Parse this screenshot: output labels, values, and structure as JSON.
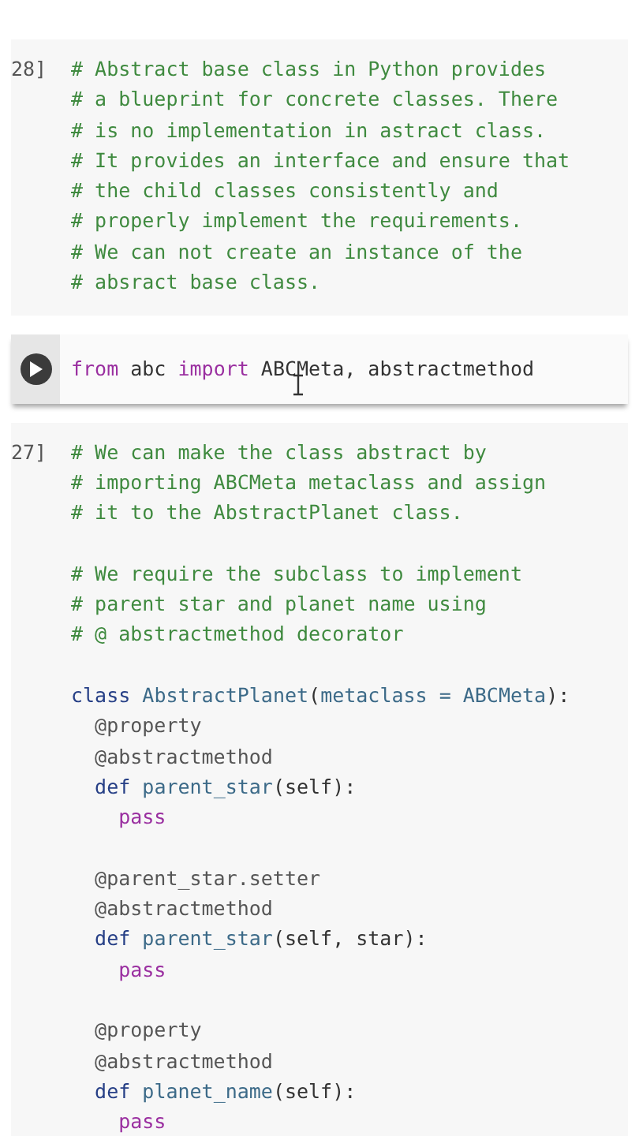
{
  "cells": [
    {
      "kind": "executed",
      "prompt": "28]",
      "lines": [
        {
          "tokens": [
            {
              "text": "# Abstract base class in Python provides",
              "kind": "comment"
            }
          ]
        },
        {
          "tokens": [
            {
              "text": "# a blueprint for concrete classes. There",
              "kind": "comment"
            }
          ]
        },
        {
          "tokens": [
            {
              "text": "# is no implementation in astract class.",
              "kind": "comment"
            }
          ]
        },
        {
          "tokens": [
            {
              "text": "# It provides an interface and ensure that",
              "kind": "comment"
            }
          ]
        },
        {
          "tokens": [
            {
              "text": "# the child classes consistently and",
              "kind": "comment"
            }
          ]
        },
        {
          "tokens": [
            {
              "text": "# properly implement the requirements.",
              "kind": "comment"
            }
          ]
        },
        {
          "tokens": [
            {
              "text": "# We can not create an instance of the",
              "kind": "comment"
            }
          ]
        },
        {
          "tokens": [
            {
              "text": "# absract base class.",
              "kind": "comment"
            }
          ]
        }
      ]
    },
    {
      "kind": "active",
      "lines": [
        {
          "tokens": [
            {
              "text": "from",
              "kind": "keyword"
            },
            {
              "text": " abc ",
              "kind": "plain"
            },
            {
              "text": "import",
              "kind": "keyword"
            },
            {
              "text": " ABCMeta, abstractmethod",
              "kind": "plain"
            }
          ]
        }
      ]
    },
    {
      "kind": "executed",
      "prompt": "27]",
      "lines": [
        {
          "tokens": [
            {
              "text": "# We can make the class abstract by",
              "kind": "comment"
            }
          ]
        },
        {
          "tokens": [
            {
              "text": "# importing ABCMeta metaclass and assign",
              "kind": "comment"
            }
          ]
        },
        {
          "tokens": [
            {
              "text": "# it to the AbstractPlanet class.",
              "kind": "comment"
            }
          ]
        },
        {
          "space_before": true,
          "tokens": [
            {
              "text": "# We require the subclass to implement",
              "kind": "comment"
            }
          ]
        },
        {
          "tokens": [
            {
              "text": "# parent star and planet name using",
              "kind": "comment"
            }
          ]
        },
        {
          "tokens": [
            {
              "text": "# @ abstractmethod decorator",
              "kind": "comment"
            }
          ]
        },
        {
          "space_before": true,
          "tokens": [
            {
              "text": "class",
              "kind": "definer"
            },
            {
              "text": " AbstractPlanet",
              "kind": "name"
            },
            {
              "text": "(",
              "kind": "plain"
            },
            {
              "text": "metaclass = ABCMeta",
              "kind": "name"
            },
            {
              "text": "):",
              "kind": "plain"
            }
          ]
        },
        {
          "tokens": [
            {
              "text": "  @property",
              "kind": "decorator"
            }
          ]
        },
        {
          "tokens": [
            {
              "text": "  @abstractmethod",
              "kind": "decorator"
            }
          ]
        },
        {
          "tokens": [
            {
              "text": "  def",
              "kind": "definer"
            },
            {
              "text": " parent_star",
              "kind": "name"
            },
            {
              "text": "(self):",
              "kind": "plain"
            }
          ]
        },
        {
          "tokens": [
            {
              "text": "    pass",
              "kind": "keyword"
            }
          ]
        },
        {
          "space_before": true,
          "tokens": [
            {
              "text": "  @parent_star.setter",
              "kind": "decorator"
            }
          ]
        },
        {
          "tokens": [
            {
              "text": "  @abstractmethod",
              "kind": "decorator"
            }
          ]
        },
        {
          "tokens": [
            {
              "text": "  def",
              "kind": "definer"
            },
            {
              "text": " parent_star",
              "kind": "name"
            },
            {
              "text": "(self, star):",
              "kind": "plain"
            }
          ]
        },
        {
          "tokens": [
            {
              "text": "    pass",
              "kind": "keyword"
            }
          ]
        },
        {
          "space_before": true,
          "tokens": [
            {
              "text": "  @property",
              "kind": "decorator"
            }
          ]
        },
        {
          "tokens": [
            {
              "text": "  @abstractmethod",
              "kind": "decorator"
            }
          ]
        },
        {
          "tokens": [
            {
              "text": "  def",
              "kind": "definer"
            },
            {
              "text": " planet_name",
              "kind": "name"
            },
            {
              "text": "(self):",
              "kind": "plain"
            }
          ]
        },
        {
          "tokens": [
            {
              "text": "    pass",
              "kind": "keyword"
            }
          ]
        }
      ]
    }
  ]
}
